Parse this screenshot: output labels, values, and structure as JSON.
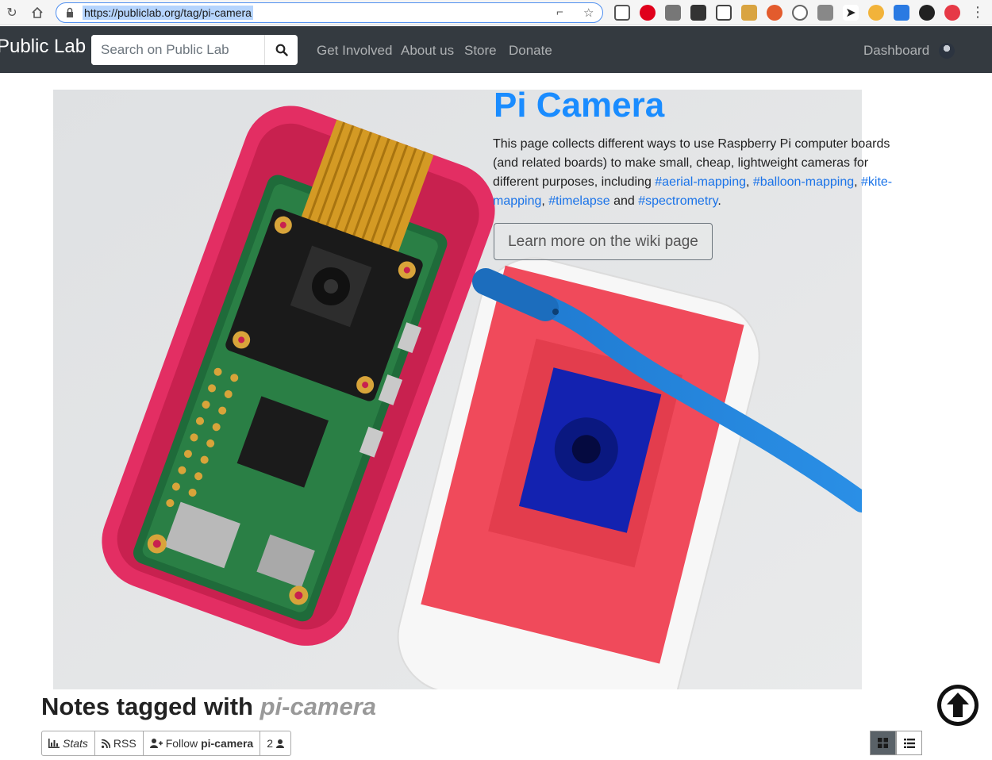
{
  "browser": {
    "url": "https://publiclab.org/tag/pi-camera"
  },
  "navbar": {
    "brand": "Public Lab",
    "search_placeholder": "Search on Public Lab",
    "links": [
      "Get Involved",
      "About us",
      "Store",
      "Donate"
    ],
    "dashboard": "Dashboard"
  },
  "hero": {
    "title": "Pi Camera",
    "description_prefix": "This page collects different ways to use Raspberry Pi computer boards (and related boards) to make small, cheap, lightweight cameras for different purposes, including ",
    "tags": [
      "#aerial-mapping",
      "#balloon-mapping",
      "#kite-mapping",
      "#timelapse",
      "#spectrometry"
    ],
    "separator": ", ",
    "conjunction": " and ",
    "description_suffix": ".",
    "wiki_button": "Learn more on the wiki page"
  },
  "notes": {
    "heading_prefix": "Notes tagged with ",
    "tag": "pi-camera",
    "stats_label": "Stats",
    "rss_label": "RSS",
    "follow_label": "Follow ",
    "follow_tag": "pi-camera",
    "follower_count": "2"
  },
  "colors": {
    "navbar_bg": "#343a40",
    "link_blue": "#1a73e8",
    "title_blue": "#1a8cff",
    "case_pink": "#e8336b"
  }
}
